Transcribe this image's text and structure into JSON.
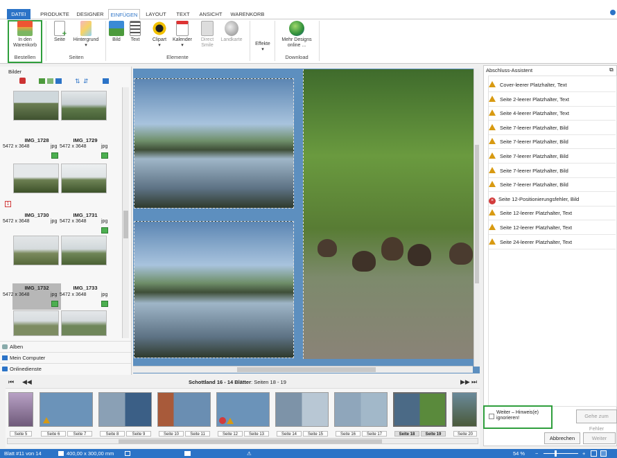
{
  "tabs": [
    "DATEI",
    "PRODUKTE",
    "DESIGNER",
    "EINFÜGEN",
    "LAYOUT",
    "TEXT",
    "ANSICHT",
    "WARENKORB"
  ],
  "ribbon": {
    "order_label": "In den Warenkorb",
    "page_label": "Seite",
    "background_label": "Hintergrund",
    "image_label": "Bild",
    "text_label": "Text",
    "clipart_label": "Clipart",
    "calendar_label": "Kalender",
    "directsmile_label": "Direct Smile",
    "map_label": "Landkarte",
    "effects_label": "Effekte",
    "more_designs_label": "Mehr Designs online ...",
    "groups": [
      "Bestellen",
      "Seiten",
      "Elemente",
      "Download"
    ]
  },
  "left_panel": {
    "title": "Bilder",
    "images": [
      {
        "name": "IMG_1728",
        "size": "5472 x 3648",
        "type": "jpg"
      },
      {
        "name": "IMG_1729",
        "size": "5472 x 3648",
        "type": "jpg"
      },
      {
        "name": "IMG_1730",
        "size": "5472 x 3648",
        "type": "jpg"
      },
      {
        "name": "IMG_1731",
        "size": "5472 x 3648",
        "type": "jpg"
      },
      {
        "name": "IMG_1732",
        "size": "5472 x 3648",
        "type": "jpg"
      },
      {
        "name": "IMG_1733",
        "size": "5472 x 3648",
        "type": "jpg"
      }
    ],
    "badge": "1",
    "sources": [
      "Alben",
      "Mein Computer",
      "Onlinedienste"
    ]
  },
  "navigation": {
    "title": "Schottland 16 - 14 Blätter",
    "pages": "Seiten 18 - 19"
  },
  "filmstrip": [
    "Seite 5",
    "Seite 6",
    "Seite 7",
    "Seite 8",
    "Seite 9",
    "Seite 10",
    "Seite 11",
    "Seite 12",
    "Seite 13",
    "Seite 14",
    "Seite 15",
    "Seite 16",
    "Seite 17",
    "Seite 18",
    "Seite 19",
    "Seite 20"
  ],
  "assistant": {
    "title": "Abschluss-Assistent",
    "hints": [
      {
        "type": "warn",
        "text": "Cover-leerer Platzhalter, Text"
      },
      {
        "type": "warn",
        "text": "Seite 2-leerer Platzhalter, Text"
      },
      {
        "type": "warn",
        "text": "Seite 4-leerer Platzhalter, Text"
      },
      {
        "type": "warn",
        "text": "Seite 7-leerer Platzhalter, Bild"
      },
      {
        "type": "warn",
        "text": "Seite 7-leerer Platzhalter, Bild"
      },
      {
        "type": "warn",
        "text": "Seite 7-leerer Platzhalter, Bild"
      },
      {
        "type": "warn",
        "text": "Seite 7-leerer Platzhalter, Bild"
      },
      {
        "type": "warn",
        "text": "Seite 7-leerer Platzhalter, Bild"
      },
      {
        "type": "error",
        "text": "Seite 12-Positionierungsfehler, Bild"
      },
      {
        "type": "warn",
        "text": "Seite 12-leerer Platzhalter, Text"
      },
      {
        "type": "warn",
        "text": "Seite 12-leerer Platzhalter, Text"
      },
      {
        "type": "warn",
        "text": "Seite 24-leerer Platzhalter, Text"
      }
    ],
    "ignore_label": "Weiter – Hinweis(e) ignorieren!",
    "goto_error_label": "Gehe zum Fehler",
    "cancel_label": "Abbrechen",
    "next_label": "Weiter"
  },
  "status": {
    "sheet": "Blatt #11 von 14",
    "format": "400,00 x 300,00 mm",
    "zoom": "54 %"
  },
  "colors": {
    "accent": "#2b73c7",
    "highlight": "#2e9e3c",
    "warning": "#d89a12",
    "error": "#d23b3b"
  }
}
